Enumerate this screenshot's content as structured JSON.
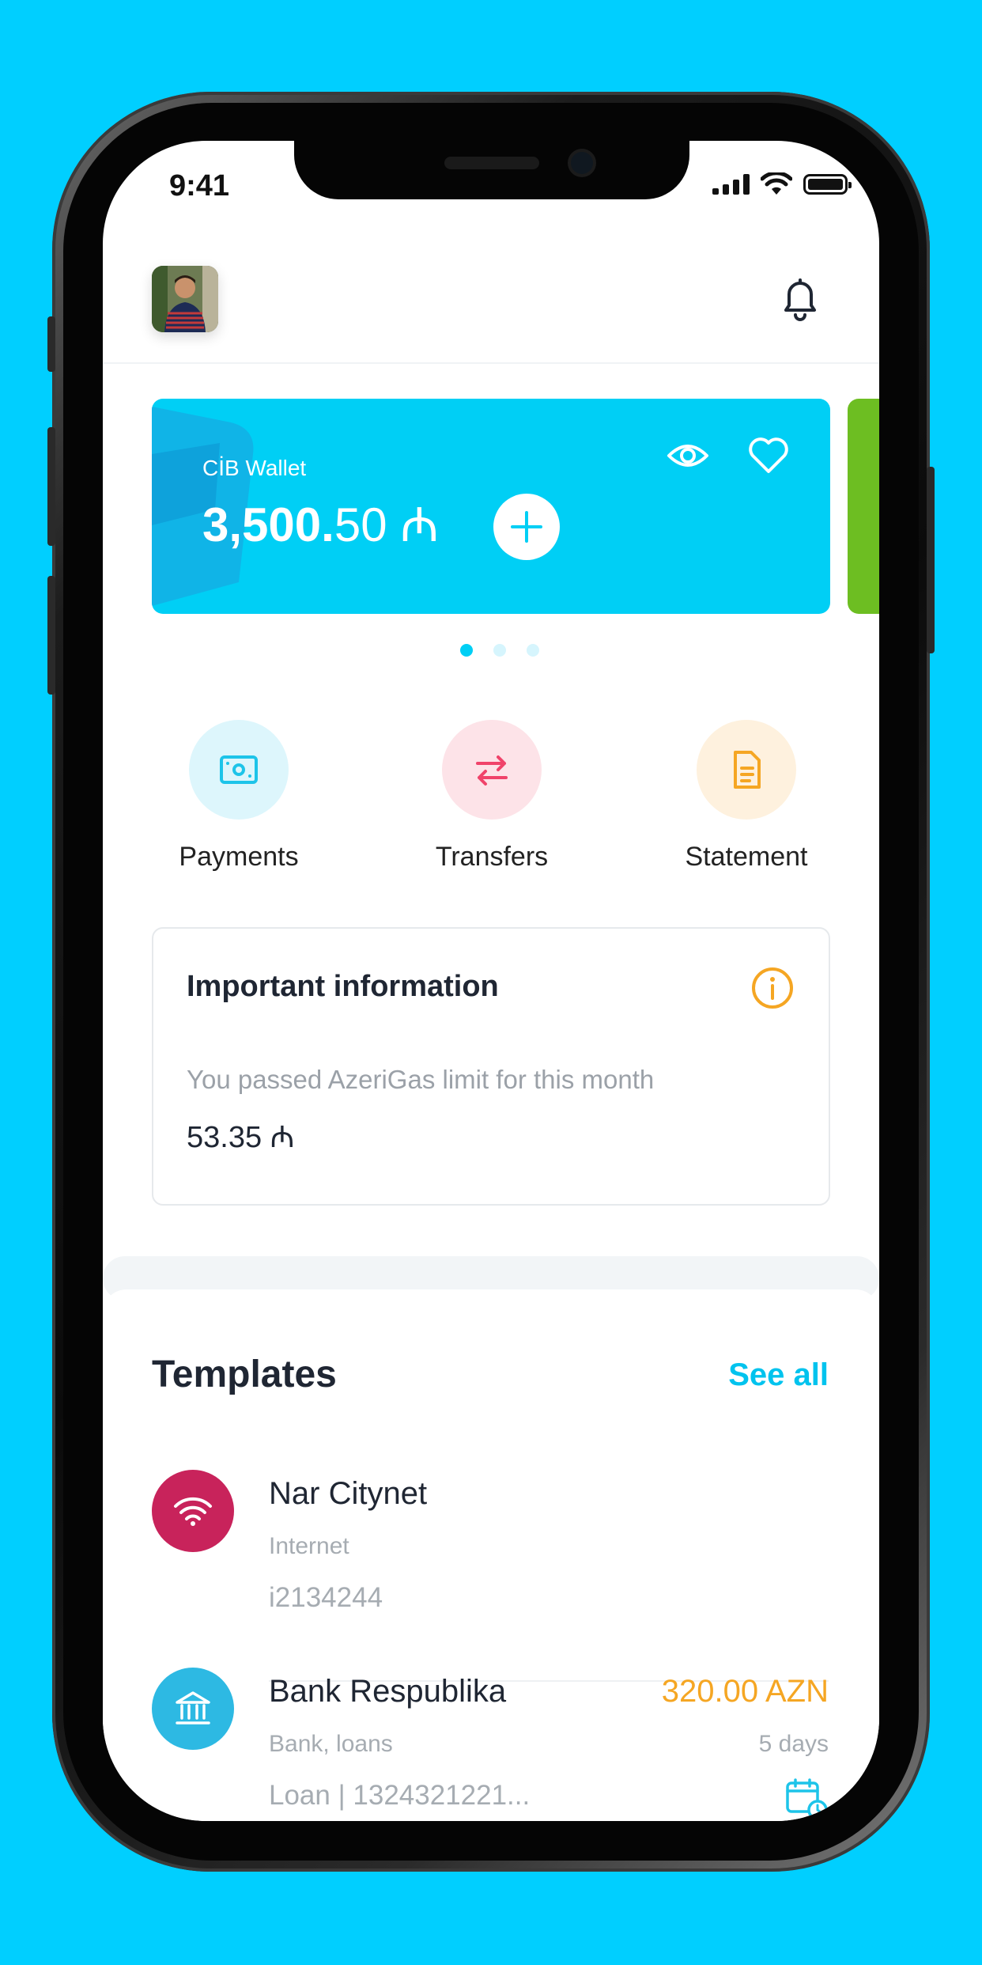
{
  "status": {
    "time": "9:41"
  },
  "wallet": {
    "label": "CİB Wallet",
    "amount_int": "3,500.",
    "amount_dec": "50",
    "currency": "₼"
  },
  "actions": [
    {
      "label": "Payments",
      "icon": "money-icon",
      "color": "#1DC4E9",
      "bg": "#DDF6FC"
    },
    {
      "label": "Transfers",
      "icon": "transfer-arrows-icon",
      "color": "#F0436A",
      "bg": "#FDE3E8"
    },
    {
      "label": "Statement",
      "icon": "document-icon",
      "color": "#F5A623",
      "bg": "#FEF1DE"
    }
  ],
  "info": {
    "title": "Important information",
    "text": "You passed AzeriGas limit for this month",
    "amount": "53.35 ₼"
  },
  "templates": {
    "title": "Templates",
    "see_all": "See all",
    "items": [
      {
        "name": "Nar Citynet",
        "category": "Internet",
        "ref": "i2134244",
        "icon": "wifi-icon",
        "color": "#C8235B"
      },
      {
        "name": "Bank Respublika",
        "category": "Bank, loans",
        "ref": "Loan | 1324321221...",
        "amount": "320.00 AZN",
        "due": "5 days",
        "icon": "bank-icon",
        "color": "#2DB9E3"
      }
    ]
  },
  "colors": {
    "background": "#00CFFF",
    "wallet_card": "#00CFF5",
    "next_card": "#6DBE22",
    "accent": "#00C3EE",
    "amount_orange": "#F5A623"
  }
}
